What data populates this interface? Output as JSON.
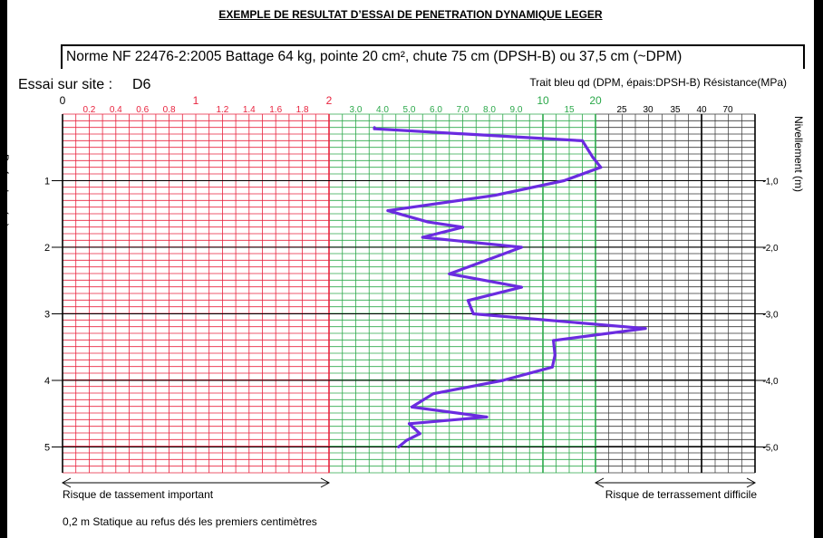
{
  "title": "EXEMPLE DE RESULTAT D’ESSAI DE PENETRATION DYNAMIQUE LEGER",
  "norm": "Norme NF 22476-2:2005    Battage 64 kg, pointe 20 cm², chute 75 cm (DPSH-B) ou 37,5 cm (~DPM)",
  "site_label": "Essai sur site :",
  "site_value": "D6",
  "legend_note": "Trait bleu qd (DPM, épais:DPSH-B) Résistance(MPa)",
  "left_axis_label": "Profondeur (m)",
  "right_axis_label": "Nivellement (m)",
  "footer_note": "0,2 m  Statique au refus dés les premiers centimètres",
  "colors": {
    "red_zone": "#e8233e",
    "green_zone": "#2ba84a",
    "black_zone": "#000000",
    "profile": "#6a2be0"
  },
  "chart_data": {
    "type": "line",
    "x_scale": "piecewise (0-2 linear, 2-10 linear, 10-20 linear, 20-70 irregular)",
    "y_axis": "depth (m), inverted",
    "ylim": [
      0,
      5.5
    ],
    "top_ticks_major": [
      {
        "label": "0",
        "value": 0,
        "color": "#000000"
      },
      {
        "label": "1",
        "value": 1,
        "color": "#e8233e"
      },
      {
        "label": "2",
        "value": 2,
        "color": "#e8233e"
      },
      {
        "label": "10",
        "value": 10,
        "color": "#2ba84a"
      },
      {
        "label": "20",
        "value": 20,
        "color": "#2ba84a"
      }
    ],
    "top_ticks_minor": [
      {
        "label": "0.2",
        "value": 0.2,
        "color": "#e8233e"
      },
      {
        "label": "0.4",
        "value": 0.4,
        "color": "#e8233e"
      },
      {
        "label": "0.6",
        "value": 0.6,
        "color": "#e8233e"
      },
      {
        "label": "0.8",
        "value": 0.8,
        "color": "#e8233e"
      },
      {
        "label": "1.2",
        "value": 1.2,
        "color": "#e8233e"
      },
      {
        "label": "1.4",
        "value": 1.4,
        "color": "#e8233e"
      },
      {
        "label": "1.6",
        "value": 1.6,
        "color": "#e8233e"
      },
      {
        "label": "1.8",
        "value": 1.8,
        "color": "#e8233e"
      },
      {
        "label": "3.0",
        "value": 3,
        "color": "#2ba84a"
      },
      {
        "label": "4.0",
        "value": 4,
        "color": "#2ba84a"
      },
      {
        "label": "5.0",
        "value": 5,
        "color": "#2ba84a"
      },
      {
        "label": "6.0",
        "value": 6,
        "color": "#2ba84a"
      },
      {
        "label": "7.0",
        "value": 7,
        "color": "#2ba84a"
      },
      {
        "label": "8.0",
        "value": 8,
        "color": "#2ba84a"
      },
      {
        "label": "9.0",
        "value": 9,
        "color": "#2ba84a"
      },
      {
        "label": "15",
        "value": 15,
        "color": "#2ba84a"
      },
      {
        "label": "25",
        "value": 25,
        "color": "#000000"
      },
      {
        "label": "30",
        "value": 30,
        "color": "#000000"
      },
      {
        "label": "35",
        "value": 35,
        "color": "#000000"
      },
      {
        "label": "40",
        "value": 40,
        "color": "#000000"
      },
      {
        "label": "70",
        "value": 70,
        "color": "#000000"
      }
    ],
    "depth_ticks": [
      "1",
      "2",
      "3",
      "4",
      "5"
    ],
    "elevation_ticks": [
      "-1,0",
      "-2,0",
      "-3,0",
      "-4,0",
      "-5,0"
    ],
    "profile": [
      {
        "depth": 0.2,
        "qd": 3.7
      },
      {
        "depth": 0.22,
        "qd": 3.7
      },
      {
        "depth": 0.4,
        "qd": 17.5
      },
      {
        "depth": 0.65,
        "qd": 19.5
      },
      {
        "depth": 0.8,
        "qd": 21.0
      },
      {
        "depth": 1.0,
        "qd": 14.0
      },
      {
        "depth": 1.22,
        "qd": 8.2
      },
      {
        "depth": 1.45,
        "qd": 4.2
      },
      {
        "depth": 1.62,
        "qd": 5.7
      },
      {
        "depth": 1.7,
        "qd": 7.0
      },
      {
        "depth": 1.85,
        "qd": 5.5
      },
      {
        "depth": 2.0,
        "qd": 9.2
      },
      {
        "depth": 2.4,
        "qd": 6.5
      },
      {
        "depth": 2.6,
        "qd": 9.2
      },
      {
        "depth": 2.8,
        "qd": 7.2
      },
      {
        "depth": 3.0,
        "qd": 7.4
      },
      {
        "depth": 3.22,
        "qd": 29.5
      },
      {
        "depth": 3.4,
        "qd": 12.0
      },
      {
        "depth": 3.62,
        "qd": 12.3
      },
      {
        "depth": 3.8,
        "qd": 11.8
      },
      {
        "depth": 4.0,
        "qd": 8.5
      },
      {
        "depth": 4.2,
        "qd": 5.9
      },
      {
        "depth": 4.4,
        "qd": 5.1
      },
      {
        "depth": 4.55,
        "qd": 7.9
      },
      {
        "depth": 4.65,
        "qd": 5.0
      },
      {
        "depth": 4.8,
        "qd": 5.4
      },
      {
        "depth": 4.9,
        "qd": 4.9
      },
      {
        "depth": 5.0,
        "qd": 4.6
      }
    ],
    "bottom_labels": {
      "left": "Risque de tassement important",
      "right": "Risque de terrassement difficile"
    }
  }
}
